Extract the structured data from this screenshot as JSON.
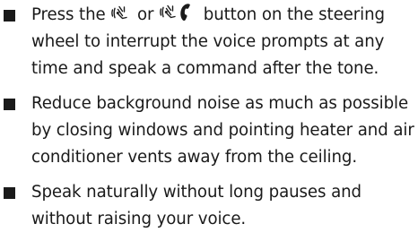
{
  "tips": [
    {
      "text_before_icon_1": "Press the ",
      "icon_1": "voice-recognition-icon",
      "text_between_icons": " or ",
      "icon_2": "voice-recognition-phone-icon",
      "text_after_icon_2": " button on the steering wheel to interrupt the voice prompts at any time and speak a command after the tone."
    },
    {
      "text": "Reduce background noise as much as possible by closing windows and pointing heater and air conditioner vents away from the ceiling."
    },
    {
      "text": "Speak naturally without long pauses and without raising your voice."
    }
  ]
}
